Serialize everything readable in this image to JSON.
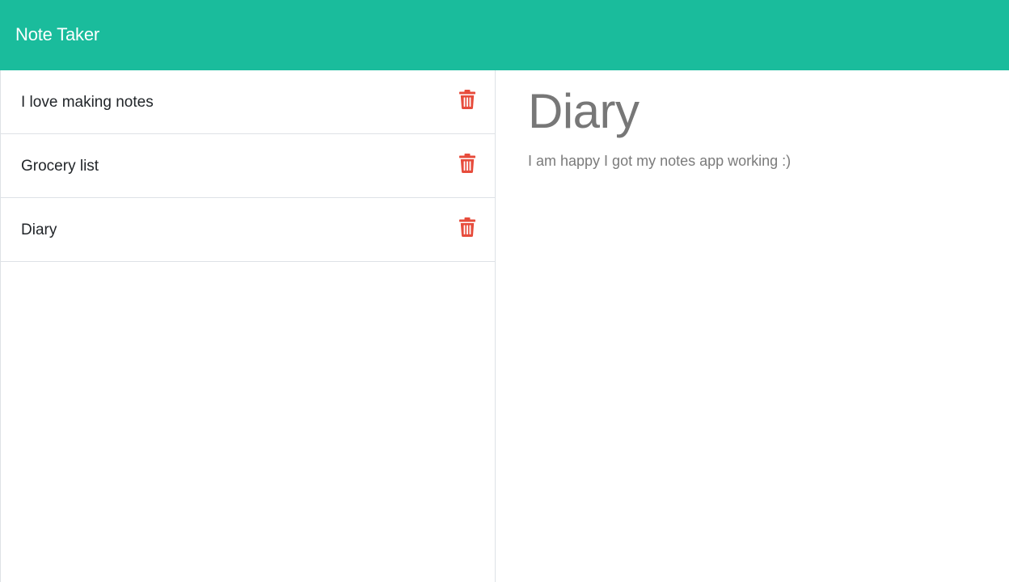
{
  "app": {
    "title": "Note Taker"
  },
  "notes": [
    {
      "title": "I love making notes",
      "delete_icon": "trash-icon"
    },
    {
      "title": "Grocery list",
      "delete_icon": "trash-icon"
    },
    {
      "title": "Diary",
      "delete_icon": "trash-icon"
    }
  ],
  "active_note": {
    "title": "Diary",
    "text": "I am happy I got my notes app working :)"
  },
  "colors": {
    "navbar": "#1abc9c",
    "delete_icon": "#e74c3c",
    "heading_text": "#777777"
  }
}
